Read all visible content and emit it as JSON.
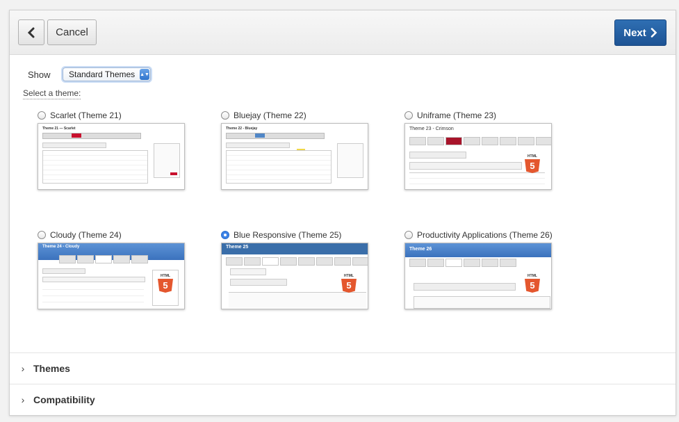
{
  "toolbar": {
    "cancel_label": "Cancel",
    "next_label": "Next"
  },
  "filter": {
    "show_label": "Show",
    "selected": "Standard Themes"
  },
  "select_theme_label": "Select a theme:",
  "themes": [
    {
      "label": "Scarlet (Theme 21)",
      "thumb_title": "Theme 21 — Scarlet",
      "selected": false,
      "accent": "#c8102e"
    },
    {
      "label": "Bluejay (Theme 22)",
      "thumb_title": "Theme 22 - Bluejay",
      "selected": false,
      "accent": "#4f86c6"
    },
    {
      "label": "Uniframe (Theme 23)",
      "thumb_title": "Theme 23 - Crimson",
      "selected": false,
      "accent": "#a8142a"
    },
    {
      "label": "Cloudy (Theme 24)",
      "thumb_title": "Theme 24 - Cloudy",
      "selected": false,
      "accent": "#3b72bd"
    },
    {
      "label": "Blue Responsive (Theme 25)",
      "thumb_title": "Theme 25",
      "selected": true,
      "accent": "#3a6ea9"
    },
    {
      "label": "Productivity Applications (Theme 26)",
      "thumb_title": "Theme 26",
      "selected": false,
      "accent": "#3b72bd"
    }
  ],
  "html5_badge": {
    "top": "HTML",
    "glyph": "5"
  },
  "sections": [
    {
      "label": "Themes"
    },
    {
      "label": "Compatibility"
    }
  ],
  "colors": {
    "primary": "#245ea4",
    "selected_radio": "#3b82e6"
  }
}
